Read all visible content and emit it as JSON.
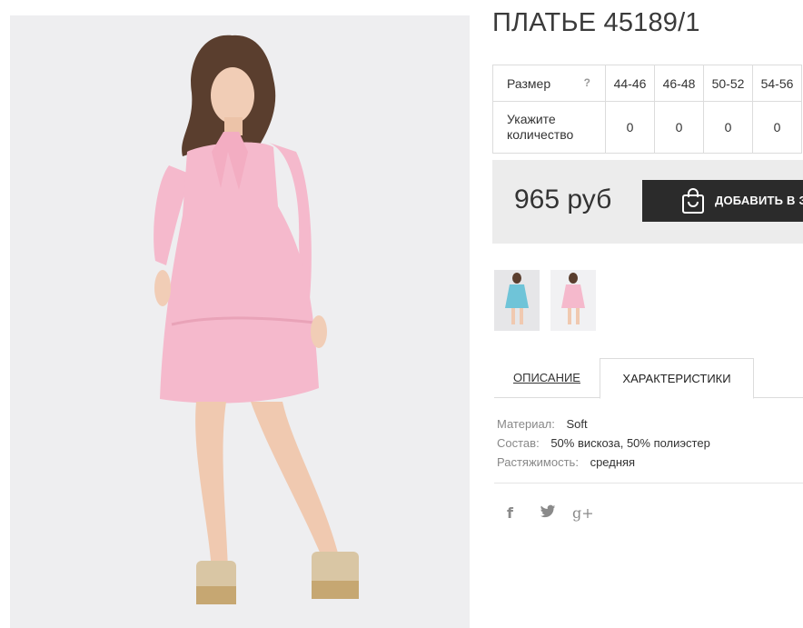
{
  "product": {
    "title": "ПЛАТЬЕ 45189/1",
    "main_image_alt": "pink-tiered-dress-model-photo"
  },
  "size_table": {
    "size_label": "Размер",
    "help_mark": "?",
    "sizes": [
      "44-46",
      "46-48",
      "50-52",
      "54-56"
    ],
    "qty_label": "Укажите количество",
    "quantities": [
      "0",
      "0",
      "0",
      "0"
    ]
  },
  "purchase": {
    "price": "965 руб",
    "add_to_cart_label": "ДОБАВИТЬ В ЗАКАЗ",
    "icon": "shopping-bag-icon"
  },
  "thumbnails": [
    {
      "name": "blue-dress-thumbnail"
    },
    {
      "name": "pink-dress-thumbnail"
    }
  ],
  "tabs": {
    "description": "ОПИСАНИЕ",
    "characteristics": "ХАРАКТЕРИСТИКИ",
    "active": "characteristics"
  },
  "characteristics": [
    {
      "key": "Материал:",
      "value": "Soft"
    },
    {
      "key": "Состав:",
      "value": "50% вискоза, 50% полиэстер"
    },
    {
      "key": "Растяжимость:",
      "value": "средняя"
    }
  ],
  "share": {
    "facebook_glyph": "f",
    "google_plus_glyph": "g+",
    "icons": [
      "facebook-icon",
      "twitter-icon",
      "google-plus-icon"
    ]
  },
  "colors": {
    "dress_pink": "#f5b9cc",
    "dark_button": "#2b2b2b",
    "price_box_bg": "#ececec",
    "border": "#dcdcdc"
  }
}
